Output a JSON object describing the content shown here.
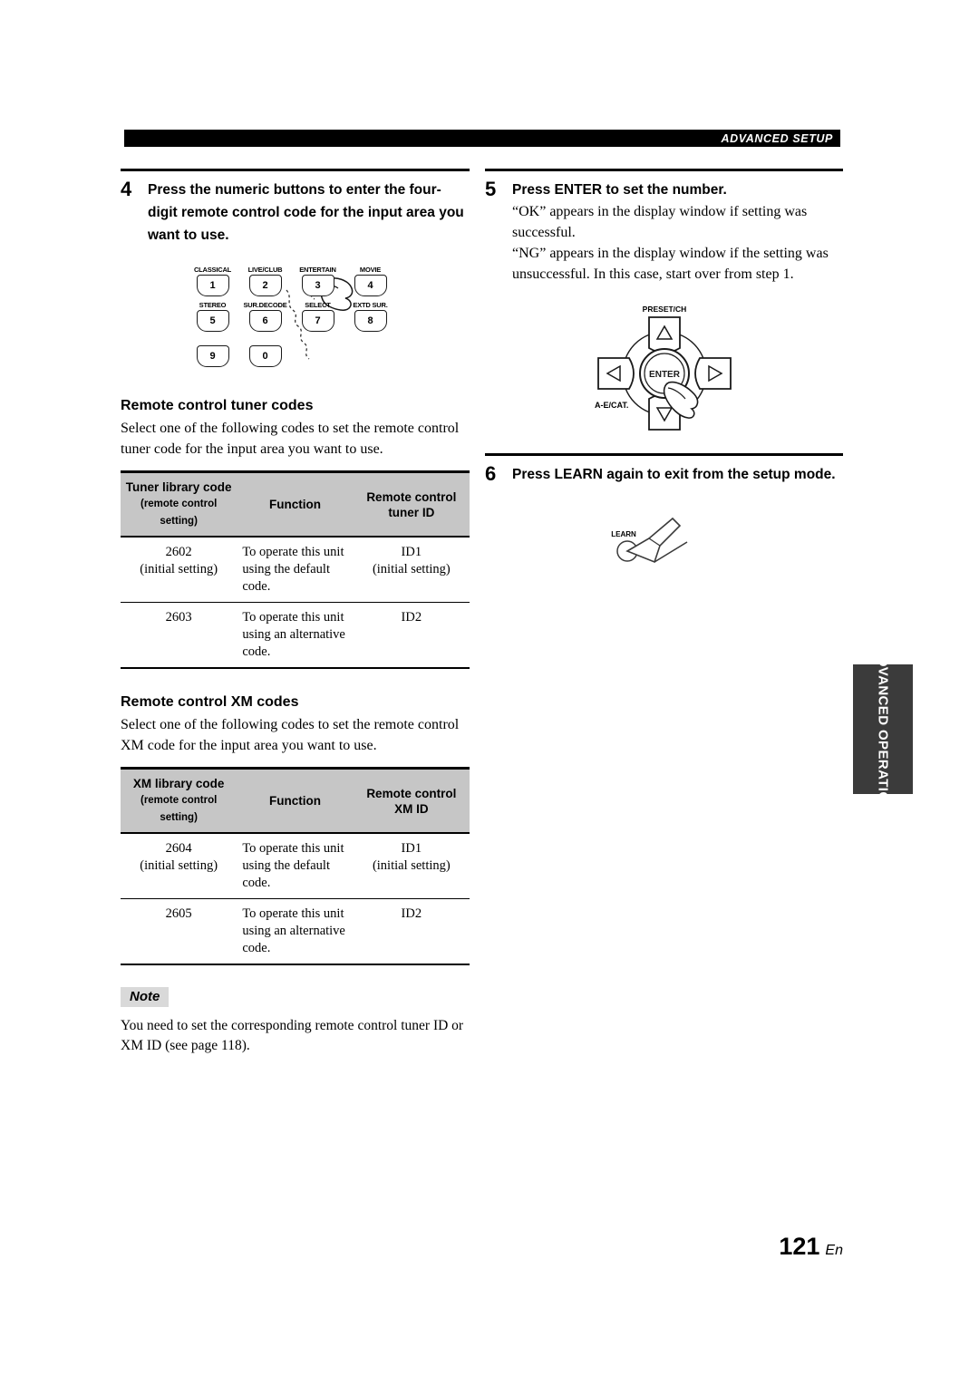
{
  "header": {
    "running_title": "ADVANCED SETUP"
  },
  "steps": {
    "step4": {
      "number": "4",
      "title": "Press the numeric buttons to enter the four-digit remote control code for the input area you want to use."
    },
    "step5": {
      "number": "5",
      "title": "Press ENTER to set the number.",
      "body_line1": "“OK” appears in the display window if setting was successful.",
      "body_line2": "“NG” appears in the display window if the setting was unsuccessful. In this case, start over from step 1."
    },
    "step6": {
      "number": "6",
      "title": "Press LEARN again to exit from the setup mode."
    }
  },
  "keypad": {
    "rows": [
      [
        {
          "label": "CLASSICAL",
          "digit": "1"
        },
        {
          "label": "LIVE/CLUB",
          "digit": "2"
        },
        {
          "label": "ENTERTAIN",
          "digit": "3"
        },
        {
          "label": "MOVIE",
          "digit": "4"
        }
      ],
      [
        {
          "label": "STEREO",
          "digit": "5"
        },
        {
          "label": "SUR.DECODE",
          "digit": "6"
        },
        {
          "label": "SELECT",
          "digit": "7"
        },
        {
          "label": "EXTD SUR.",
          "digit": "8"
        }
      ],
      [
        {
          "label": "",
          "digit": "9"
        },
        {
          "label": "",
          "digit": "0"
        }
      ]
    ]
  },
  "cursor_pad": {
    "top_label": "PRESET/CH",
    "left_label": "A-E/CAT.",
    "center_label": "ENTER"
  },
  "learn_button": {
    "label": "LEARN"
  },
  "tuner_section": {
    "heading": "Remote control tuner codes",
    "intro": "Select one of the following codes to set the remote control tuner code for the input area you want to use.",
    "columns": {
      "code_main": "Tuner library code",
      "code_sub": "(remote control setting)",
      "function": "Function",
      "id": "Remote control tuner ID"
    },
    "rows": [
      {
        "code": "2602",
        "code_note": "(initial setting)",
        "function": "To operate this unit using the default code.",
        "id": "ID1",
        "id_note": "(initial setting)"
      },
      {
        "code": "2603",
        "code_note": "",
        "function": "To operate this unit using an alternative code.",
        "id": "ID2",
        "id_note": ""
      }
    ]
  },
  "xm_section": {
    "heading": "Remote control XM codes",
    "intro": "Select one of the following codes to set the remote control XM code for the input area you want to use.",
    "columns": {
      "code_main": "XM library code",
      "code_sub": "(remote control setting)",
      "function": "Function",
      "id": "Remote control XM ID"
    },
    "rows": [
      {
        "code": "2604",
        "code_note": "(initial setting)",
        "function": "To operate this unit using the default code.",
        "id": "ID1",
        "id_note": "(initial setting)"
      },
      {
        "code": "2605",
        "code_note": "",
        "function": "To operate this unit using an alternative code.",
        "id": "ID2",
        "id_note": ""
      }
    ]
  },
  "note": {
    "badge": "Note",
    "text": "You need to set the corresponding remote control tuner ID or XM ID (see page 118)."
  },
  "side_tab": {
    "text": "ADVANCED OPERATION"
  },
  "footer": {
    "page_number": "121",
    "language": "En"
  },
  "colors": {
    "header_bar": "#000000",
    "table_header_bg": "#c6c6c6",
    "note_badge_bg": "#d9d9d9",
    "side_tab_bg": "#3b3b3b"
  }
}
